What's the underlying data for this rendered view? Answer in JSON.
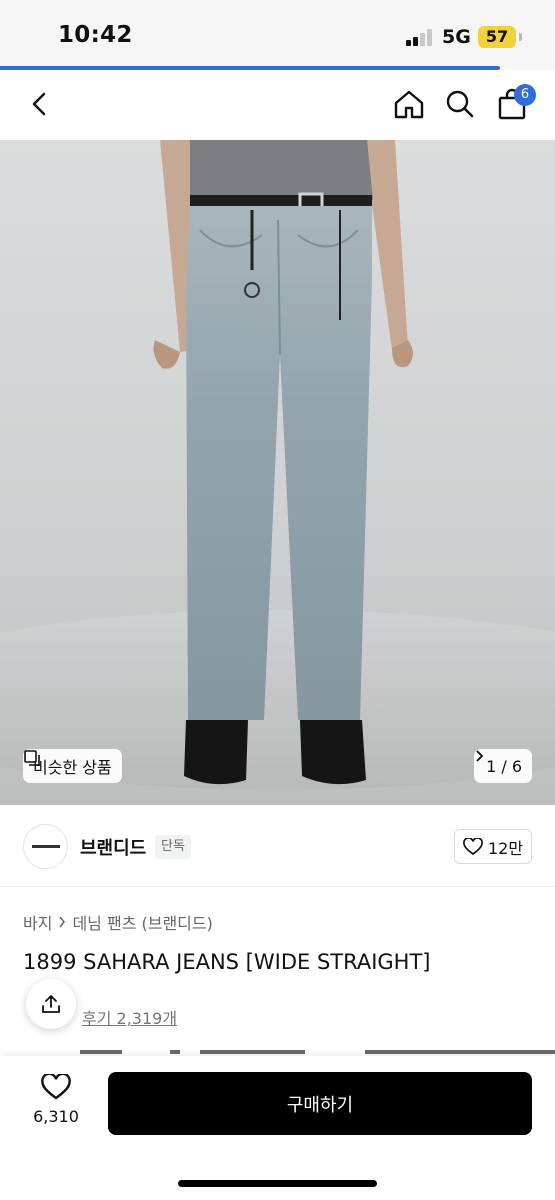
{
  "status_bar": {
    "time": "10:42",
    "network": "5G",
    "battery": "57",
    "load_progress_percent": 90
  },
  "nav": {
    "cart_count": "6",
    "icons": [
      "back-icon",
      "home-icon",
      "search-icon",
      "shopping-bag-icon"
    ]
  },
  "gallery": {
    "similar_label": "비슷한 상품",
    "counter": "1 / 6"
  },
  "brand": {
    "name": "브랜디드",
    "tag": "단독",
    "likes": "12만"
  },
  "product": {
    "breadcrumb": [
      "바지",
      "데님 팬츠 (브랜디드)"
    ],
    "title": "1899 SAHARA JEANS [WIDE STRAIGHT]",
    "review_link": "후기 2,319개"
  },
  "bottom_bar": {
    "wish_count": "6,310",
    "buy_label": "구매하기"
  },
  "colors": {
    "accent": "#2f6ed8",
    "battery": "#f2d23a",
    "buy_button": "#000000"
  }
}
